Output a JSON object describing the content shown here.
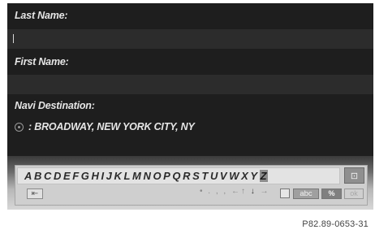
{
  "form": {
    "last_name_label": "Last Name:",
    "last_name_value": "",
    "first_name_label": "First Name:",
    "first_name_value": "",
    "navi_label": "Navi Destination:",
    "navi_value": ": BROADWAY, NEW YORK CITY, NY"
  },
  "keyboard": {
    "letters_before": "ABCDEFGHIJKLMNOPQRSTUVWXY",
    "letters_highlight": "Z",
    "right_button_label": "⊡",
    "back_label": "⇤",
    "symbols_text": "• . , ,",
    "symbols_arrows": "←↑",
    "symbols_down": "↓",
    "symbols_right": "→",
    "mode_abc_label": "abc",
    "mode_num_label": "%",
    "mode_ok_label": "ok"
  },
  "caption": "P82.89-0653-31",
  "colors": {
    "screen_bg": "#1e1e1e",
    "field_bg": "#2c2c2c",
    "label_text": "#e6e6e6",
    "keyboard_bg": "#cfcfcf"
  },
  "icons": {
    "destination_icon": "target-icon",
    "back_icon": "back-arrow-icon",
    "right_button_icon": "keyboard-toggle-icon"
  }
}
